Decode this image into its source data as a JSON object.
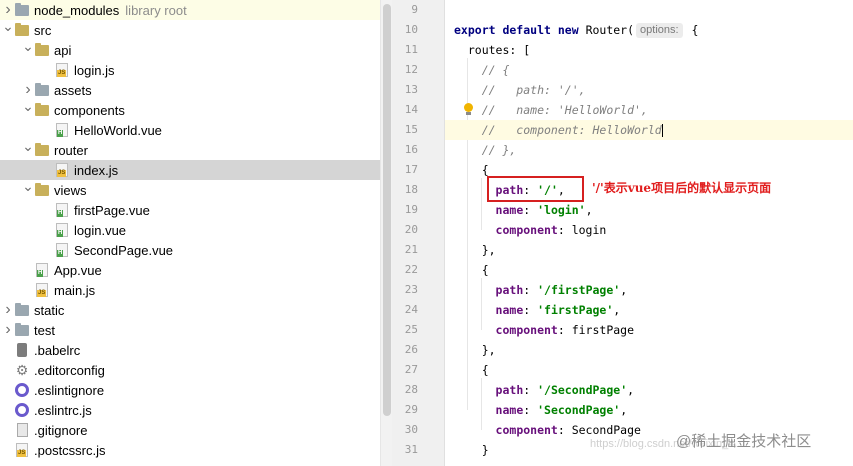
{
  "tree": {
    "rows": [
      {
        "label": "node_modules",
        "extra": "library root",
        "icon": "folder",
        "arrow": "right",
        "indent": 12,
        "state": "highlight"
      },
      {
        "label": "src",
        "icon": "folder",
        "arrow": "down",
        "indent": 12
      },
      {
        "label": "api",
        "icon": "folder",
        "arrow": "down",
        "indent": 32
      },
      {
        "label": "login.js",
        "icon": "js",
        "arrow": "",
        "indent": 52
      },
      {
        "label": "assets",
        "icon": "folder",
        "arrow": "right",
        "indent": 32
      },
      {
        "label": "components",
        "icon": "folder",
        "arrow": "down",
        "indent": 32
      },
      {
        "label": "HelloWorld.vue",
        "icon": "vue",
        "arrow": "",
        "indent": 52
      },
      {
        "label": "router",
        "icon": "folder",
        "arrow": "down",
        "indent": 32
      },
      {
        "label": "index.js",
        "icon": "js",
        "arrow": "",
        "indent": 52,
        "state": "selected"
      },
      {
        "label": "views",
        "icon": "folder",
        "arrow": "down",
        "indent": 32
      },
      {
        "label": "firstPage.vue",
        "icon": "vue",
        "arrow": "",
        "indent": 52
      },
      {
        "label": "login.vue",
        "icon": "vue",
        "arrow": "",
        "indent": 52
      },
      {
        "label": "SecondPage.vue",
        "icon": "vue",
        "arrow": "",
        "indent": 52
      },
      {
        "label": "App.vue",
        "icon": "vue",
        "arrow": "",
        "indent": 32
      },
      {
        "label": "main.js",
        "icon": "js",
        "arrow": "",
        "indent": 32
      },
      {
        "label": "static",
        "icon": "folder",
        "arrow": "right",
        "indent": 12
      },
      {
        "label": "test",
        "icon": "folder",
        "arrow": "right",
        "indent": 12
      },
      {
        "label": ".babelrc",
        "icon": "babel",
        "arrow": "",
        "indent": 12
      },
      {
        "label": ".editorconfig",
        "icon": "gear",
        "arrow": "",
        "indent": 12
      },
      {
        "label": ".eslintignore",
        "icon": "eslint",
        "arrow": "",
        "indent": 12
      },
      {
        "label": ".eslintrc.js",
        "icon": "eslint",
        "arrow": "",
        "indent": 12
      },
      {
        "label": ".gitignore",
        "icon": "git",
        "arrow": "",
        "indent": 12
      },
      {
        "label": ".postcssrc.js",
        "icon": "js",
        "arrow": "",
        "indent": 12
      }
    ]
  },
  "editor": {
    "line_numbers": [
      "9",
      "10",
      "11",
      "12",
      "13",
      "14",
      "15",
      "16",
      "17",
      "18",
      "19",
      "20",
      "21",
      "22",
      "23",
      "24",
      "25",
      "26",
      "27",
      "28",
      "29",
      "30",
      "31"
    ],
    "lines": [
      [],
      [
        {
          "t": "export default new ",
          "c": "kw"
        },
        {
          "t": "Router(",
          "c": ""
        },
        {
          "t": "options:",
          "c": "hint"
        },
        {
          "t": " {",
          "c": ""
        }
      ],
      [
        {
          "t": "  routes: [",
          "c": ""
        }
      ],
      [
        {
          "t": "    // {",
          "c": "cm"
        }
      ],
      [
        {
          "t": "    //   path: '/',",
          "c": "cm"
        }
      ],
      [
        {
          "t": "    //   name: 'HelloWorld',",
          "c": "cm"
        }
      ],
      [
        {
          "t": "    //   component: HelloWorld",
          "c": "cm"
        },
        {
          "t": "",
          "c": "caret"
        }
      ],
      [
        {
          "t": "    // },",
          "c": "cm"
        }
      ],
      [
        {
          "t": "    {",
          "c": ""
        }
      ],
      [
        {
          "t": "      ",
          "c": ""
        },
        {
          "t": "path",
          "c": "prop"
        },
        {
          "t": ": ",
          "c": ""
        },
        {
          "t": "'/'",
          "c": "str"
        },
        {
          "t": ",",
          "c": ""
        }
      ],
      [
        {
          "t": "      ",
          "c": ""
        },
        {
          "t": "name",
          "c": "prop"
        },
        {
          "t": ": ",
          "c": ""
        },
        {
          "t": "'login'",
          "c": "str"
        },
        {
          "t": ",",
          "c": ""
        }
      ],
      [
        {
          "t": "      ",
          "c": ""
        },
        {
          "t": "component",
          "c": "prop"
        },
        {
          "t": ": login",
          "c": ""
        }
      ],
      [
        {
          "t": "    },",
          "c": ""
        }
      ],
      [
        {
          "t": "    {",
          "c": ""
        }
      ],
      [
        {
          "t": "      ",
          "c": ""
        },
        {
          "t": "path",
          "c": "prop"
        },
        {
          "t": ": ",
          "c": ""
        },
        {
          "t": "'/firstPage'",
          "c": "str"
        },
        {
          "t": ",",
          "c": ""
        }
      ],
      [
        {
          "t": "      ",
          "c": ""
        },
        {
          "t": "name",
          "c": "prop"
        },
        {
          "t": ": ",
          "c": ""
        },
        {
          "t": "'firstPage'",
          "c": "str"
        },
        {
          "t": ",",
          "c": ""
        }
      ],
      [
        {
          "t": "      ",
          "c": ""
        },
        {
          "t": "component",
          "c": "prop"
        },
        {
          "t": ": firstPage",
          "c": ""
        }
      ],
      [
        {
          "t": "    },",
          "c": ""
        }
      ],
      [
        {
          "t": "    {",
          "c": ""
        }
      ],
      [
        {
          "t": "      ",
          "c": ""
        },
        {
          "t": "path",
          "c": "prop"
        },
        {
          "t": ": ",
          "c": ""
        },
        {
          "t": "'/SecondPage'",
          "c": "str"
        },
        {
          "t": ",",
          "c": ""
        }
      ],
      [
        {
          "t": "      ",
          "c": ""
        },
        {
          "t": "name",
          "c": "prop"
        },
        {
          "t": ": ",
          "c": ""
        },
        {
          "t": "'SecondPage'",
          "c": "str"
        },
        {
          "t": ",",
          "c": ""
        }
      ],
      [
        {
          "t": "      ",
          "c": ""
        },
        {
          "t": "component",
          "c": "prop"
        },
        {
          "t": ": SecondPage",
          "c": ""
        }
      ],
      [
        {
          "t": "    }",
          "c": ""
        }
      ]
    ],
    "current_line_index": 6,
    "annotation": "'/'表示vue项目后的默认显示页面",
    "watermark": "@稀土掘金技术社区",
    "watermark_faint": "https://blog.csdn.net/weixin_4..."
  },
  "colors": {
    "keyword": "#000080",
    "comment": "#808080",
    "string": "#008000",
    "property": "#660e7a",
    "annotation_red": "#e11d1d",
    "selection_row": "#d5d5d5"
  }
}
